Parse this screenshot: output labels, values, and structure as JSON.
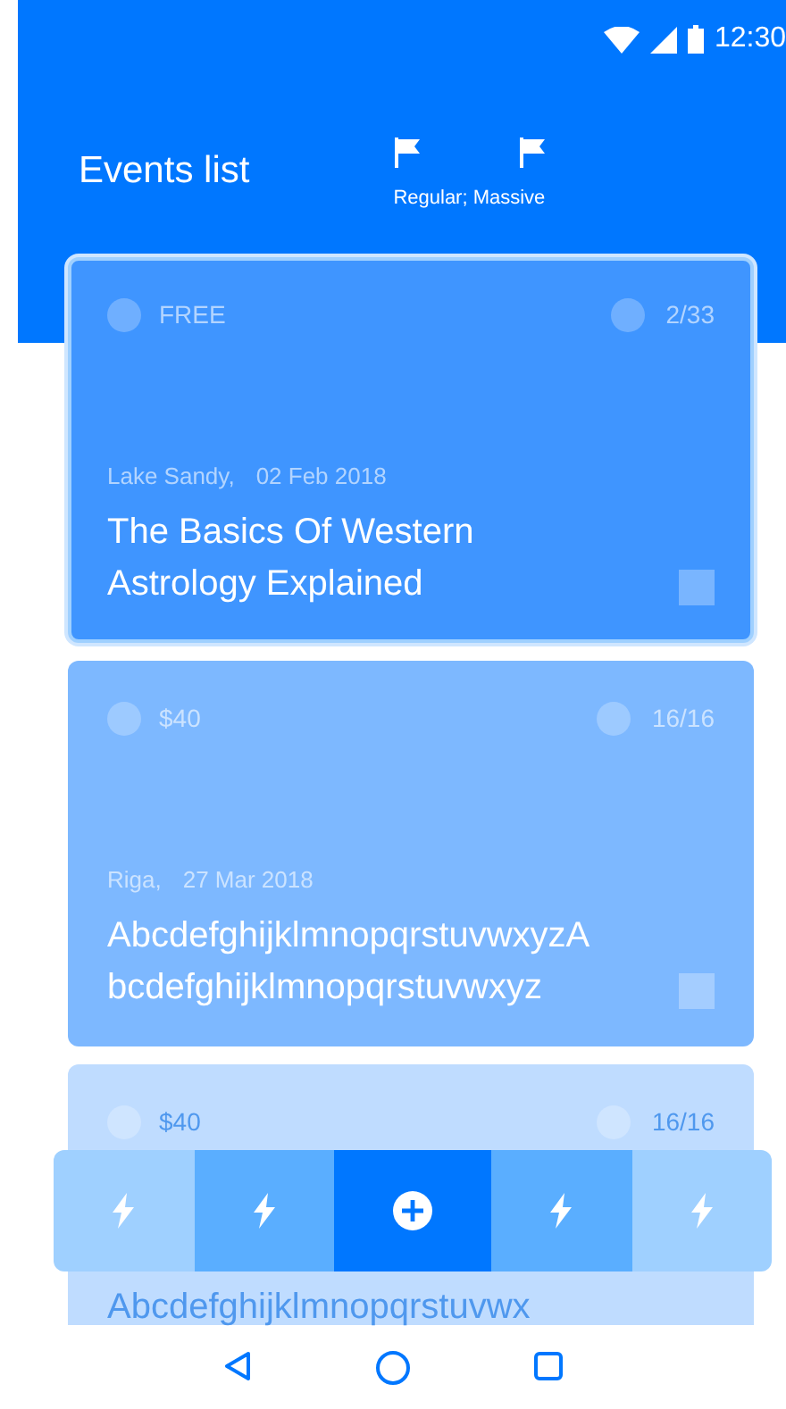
{
  "status_bar": {
    "time": "12:30"
  },
  "header": {
    "title": "Events list",
    "filter_caption": "Regular; Massive"
  },
  "events": [
    {
      "price": "FREE",
      "count": "2/33",
      "place": "Lake Sandy,",
      "date": "02 Feb 2018",
      "title": "The Basics Of Western Astrology Explained",
      "selected": true,
      "color": "#3f95ff"
    },
    {
      "price": "$40",
      "count": "16/16",
      "place": "Riga,",
      "date": "27 Mar 2018",
      "title": "AbcdefghijklmnopqrstuvwxyzAbcdefghijklmnopqrstuvwxyz",
      "selected": false,
      "color": "#7db8ff"
    },
    {
      "price": "$40",
      "count": "16/16",
      "title": "Abcdefghijklmnopqrstuvwx",
      "selected": false,
      "color": "#bfdcff"
    }
  ],
  "tab_bar": [
    {
      "kind": "bolt",
      "selected": false,
      "color": "#9fd0ff"
    },
    {
      "kind": "bolt",
      "selected": false,
      "color": "#5aaeff"
    },
    {
      "kind": "add",
      "selected": true,
      "color": "#0077ff"
    },
    {
      "kind": "bolt",
      "selected": false,
      "color": "#5aaeff"
    },
    {
      "kind": "bolt",
      "selected": false,
      "color": "#9fd0ff"
    }
  ]
}
